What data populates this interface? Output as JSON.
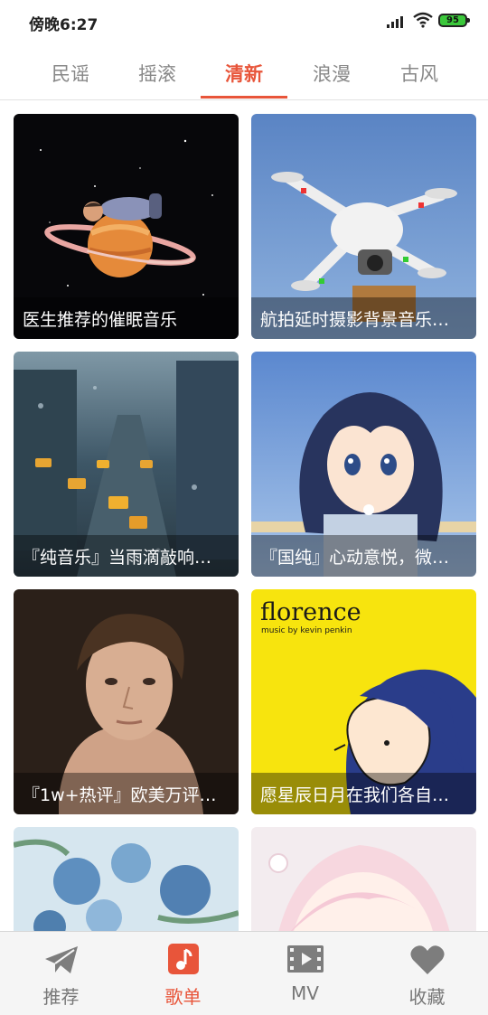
{
  "status_bar": {
    "time": "傍晚6:27",
    "battery": "95"
  },
  "tabs": [
    {
      "label": "民谣"
    },
    {
      "label": "摇滚"
    },
    {
      "label": "清新"
    },
    {
      "label": "浪漫"
    },
    {
      "label": "古风"
    }
  ],
  "active_tab": "清新",
  "playlists": [
    {
      "title": "医生推荐的催眠音乐"
    },
    {
      "title": "航拍延时摄影背景音乐…"
    },
    {
      "title": "『纯音乐』当雨滴敲响…"
    },
    {
      "title": "『国纯』心动意悦，微…"
    },
    {
      "title": "『1w+热评』欧美万评…"
    },
    {
      "title": "愿星辰日月在我们各自…"
    },
    {
      "title": ""
    },
    {
      "title": ""
    }
  ],
  "cover_text": {
    "florence_title": "florence",
    "florence_sub": "music by kevin penkin"
  },
  "bottom_nav": [
    {
      "label": "推荐",
      "icon": "paper-plane-icon"
    },
    {
      "label": "歌单",
      "icon": "music-note-icon"
    },
    {
      "label": "MV",
      "icon": "film-play-icon"
    },
    {
      "label": "收藏",
      "icon": "heart-icon"
    }
  ],
  "colors": {
    "accent": "#e8553a"
  }
}
